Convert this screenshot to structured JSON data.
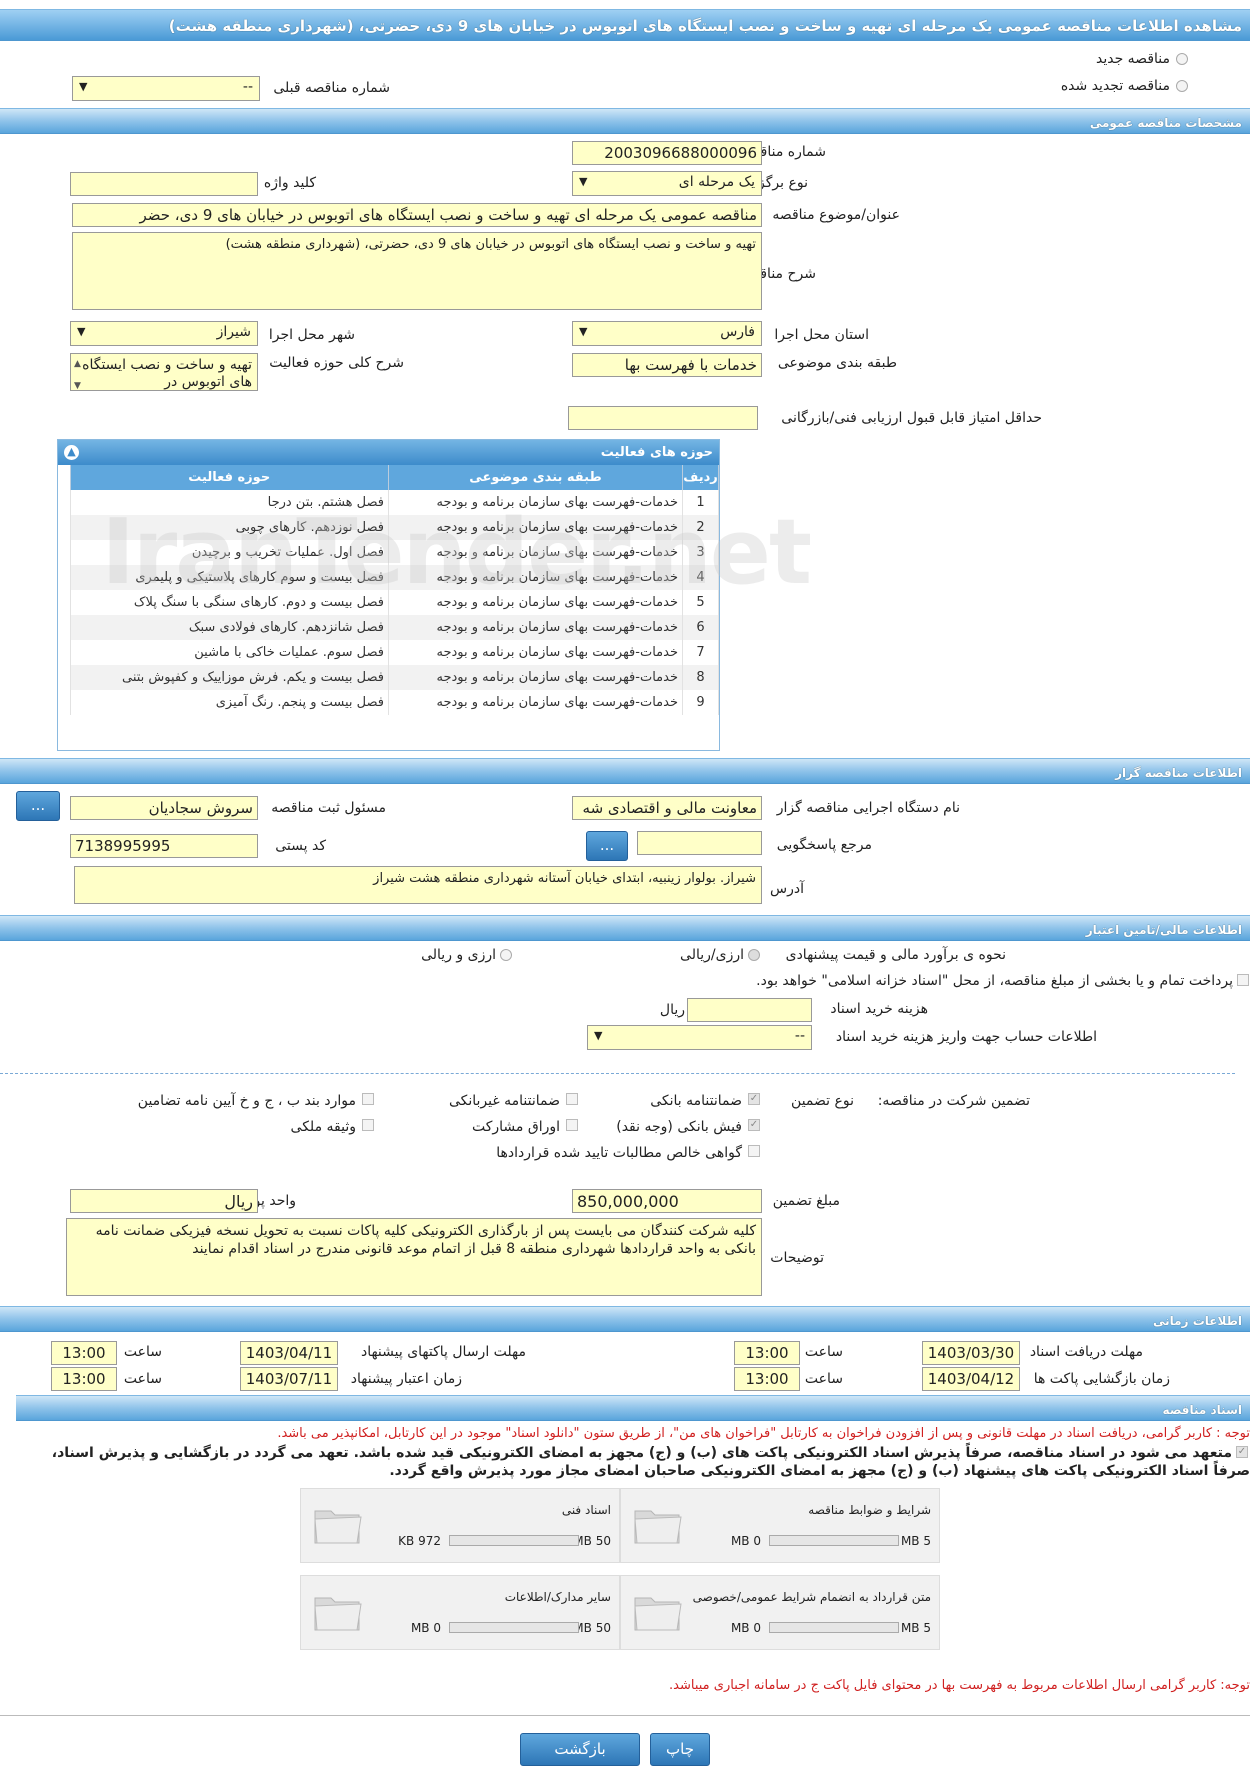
{
  "page": {
    "title": "مشاهده اطلاعات مناقصه عمومی یک مرحله ای تهیه و ساخت و نصب ایستگاه های اتوبوس در خیابان های 9 دی، حضرتی، (شهرداری منطقه هشت)"
  },
  "top": {
    "new_tender": "مناقصه جدید",
    "renewed_tender": "مناقصه تجدید شده",
    "prev_label": "شماره مناقصه قبلی",
    "prev_value": "--"
  },
  "general": {
    "header": "مشخصات مناقصه عمومی",
    "number_label": "شماره مناقصه",
    "number": "2003096688000096",
    "type_label": "نوع برگزاری",
    "type": "یک مرحله ای",
    "keyword_label": "کلید واژه",
    "keyword": "",
    "subject_label": "عنوان/موضوع مناقصه",
    "subject": "مناقصه عمومی یک مرحله ای تهیه و ساخت و نصب ایستگاه های اتوبوس در خیابان های 9 دی، حضر",
    "desc_label": "شرح مناقصه",
    "desc": "تهیه و ساخت و نصب ایستگاه های اتوبوس در خیابان های 9 دی، حضرتی، (شهرداری منطقه هشت)",
    "province_label": "استان محل اجرا",
    "province": "فارس",
    "city_label": "شهر محل اجرا",
    "city": "شیراز",
    "category_label": "طبقه بندی موضوعی",
    "category": "خدمات با فهرست بها",
    "scope_label": "شرح کلی حوزه فعالیت",
    "scope": "تهیه و ساخت و نصب ایستگاه های اتوبوس در",
    "min_score_label": "حداقل امتیاز قابل قبول ارزیابی فنی/بازرگانی",
    "min_score": ""
  },
  "activities": {
    "header": "حوزه های فعالیت",
    "col_row": "ردیف",
    "col_cat": "طبقه بندی موضوعی",
    "col_act": "حوزه فعالیت",
    "rows": [
      {
        "n": "1",
        "cat": "خدمات-فهرست بهای سازمان برنامه و بودجه",
        "act": "فصل هشتم. بتن درجا"
      },
      {
        "n": "2",
        "cat": "خدمات-فهرست بهای سازمان برنامه و بودجه",
        "act": "فصل نوزدهم. کارهای چوبی"
      },
      {
        "n": "3",
        "cat": "خدمات-فهرست بهای سازمان برنامه و بودجه",
        "act": "فصل اول. عملیات تخریب و برچیدن"
      },
      {
        "n": "4",
        "cat": "خدمات-فهرست بهای سازمان برنامه و بودجه",
        "act": "فصل بیست و سوم کارهای پلاستیکی و پلیمری"
      },
      {
        "n": "5",
        "cat": "خدمات-فهرست بهای سازمان برنامه و بودجه",
        "act": "فصل بیست و دوم. کارهای سنگی با سنگ پلاک"
      },
      {
        "n": "6",
        "cat": "خدمات-فهرست بهای سازمان برنامه و بودجه",
        "act": "فصل شانزدهم. کارهای فولادی سبک"
      },
      {
        "n": "7",
        "cat": "خدمات-فهرست بهای سازمان برنامه و بودجه",
        "act": "فصل سوم. عملیات خاکی با ماشین"
      },
      {
        "n": "8",
        "cat": "خدمات-فهرست بهای سازمان برنامه و بودجه",
        "act": "فصل بیست و یکم. فرش موزاییک و کفپوش بتنی"
      },
      {
        "n": "9",
        "cat": "خدمات-فهرست بهای سازمان برنامه و بودجه",
        "act": "فصل بیست و پنجم. رنگ آمیزی"
      }
    ]
  },
  "organizer": {
    "header": "اطلاعات مناقصه گزار",
    "org_label": "نام دستگاه اجرایی مناقصه گزار",
    "org": "معاونت مالی و اقتصادی شه",
    "resp_label": "مسئول ثبت مناقصه",
    "resp": "سروش سجادیان",
    "ref_label": "مرجع پاسخگویی",
    "ref": "",
    "postal_label": "کد پستی",
    "postal": "7138995995",
    "addr_label": "آدرس",
    "addr": "شیراز. بولوار زینبیه، ابتدای خیابان آستانه شهرداری منطقه هشت شیراز",
    "dots": "..."
  },
  "finance": {
    "header": "اطلاعات مالی/تامین اعتبار",
    "method_label": "نحوه ی برآورد مالی و قیمت پیشنهادی",
    "opt1": "ارزی/ریالی",
    "opt2": "ارزی و ریالی",
    "treasury": "پرداخت تمام و یا بخشی از مبلغ مناقصه، از محل \"اسناد خزانه اسلامی\" خواهد بود.",
    "fee_label": "هزینه خرید اسناد",
    "fee_unit": "ریال",
    "fee": "",
    "account_label": "اطلاعات حساب جهت واریز هزینه خرید اسناد",
    "account": "--"
  },
  "guarantee": {
    "label": "تضمین شرکت در مناقصه:",
    "type_label": "نوع تضمین",
    "bank_guarantee": "ضمانتنامه بانکی",
    "nonbank_guarantee": "ضمانتنامه غیربانکی",
    "clauses": "موارد بند ب ، ج و خ آیین نامه تضامین",
    "bank_receipt": "فیش بانکی (وجه نقد)",
    "bonds": "اوراق مشارکت",
    "property": "وثیقه ملکی",
    "claims": "گواهی خالص مطالبات تایید شده قراردادها",
    "amount_label": "مبلغ تضمین",
    "amount": "850,000,000",
    "currency_label": "واحد پول",
    "currency": "ریال",
    "notes_label": "توضیحات",
    "notes": "کلیه شرکت کنندگان می بایست پس از بارگذاری الکترونیکی کلیه پاکات نسبت به تحویل نسخه فیزیکی ضمانت نامه بانکی به واحد قراردادها شهرداری منطقه 8 قبل از اتمام موعد قانونی مندرج در اسناد اقدام نمایند"
  },
  "timing": {
    "header": "اطلاعات زمانی",
    "doc_receive_label": "مهلت دریافت اسناد",
    "doc_receive_date": "1403/03/30",
    "time_label": "ساعت",
    "doc_receive_time": "13:00",
    "send_label": "مهلت ارسال پاکتهای پیشنهاد",
    "send_date": "1403/04/11",
    "send_time": "13:00",
    "open_label": "زمان بازگشایی پاکت ها",
    "open_date": "1403/04/12",
    "open_time": "13:00",
    "valid_label": "زمان اعتبار پیشنهاد",
    "valid_date": "1403/07/11",
    "valid_time": "13:00"
  },
  "docs": {
    "header": "اسناد مناقصه",
    "note1": "توجه : کاربر گرامی، دریافت اسناد در مهلت قانونی و پس از افزودن فراخوان به کارتابل \"فراخوان های من\"، از طریق ستون \"دانلود اسناد\" موجود در این کارتابل، امکانپذیر می باشد.",
    "commit1": "متعهد می شود در اسناد مناقصه، صرفاً پذیرش اسناد الکترونیکی پاکت های (ب) و (ج) مجهز به امضای الکترونیکی قید شده باشد. تعهد می گردد در بازگشایی و پذیرش اسناد،",
    "commit2": "صرفاً اسناد الکترونیکی پاکت های پیشنهاد (ب) و (ج) مجهز به امضای الکترونیکی صاحبان امضای مجاز مورد پذیرش واقع گردد.",
    "files": [
      {
        "name": "شرایط و ضوابط مناقصه",
        "max": "5 MB",
        "used": "0 MB"
      },
      {
        "name": "اسناد فنی",
        "max": "50 MB",
        "used": "972 KB"
      },
      {
        "name": "متن قرارداد به انضمام شرایط عمومی/خصوصی",
        "max": "5 MB",
        "used": "0 MB"
      },
      {
        "name": "سایر مدارک/اطلاعات",
        "max": "50 MB",
        "used": "0 MB"
      }
    ],
    "note2": "توجه: کاربر گرامی ارسال اطلاعات مربوط به فهرست بها در محتوای فایل پاکت ج در سامانه اجباری میباشد."
  },
  "footer": {
    "print": "چاپ",
    "back": "بازگشت"
  },
  "watermark": "IranTender.net"
}
